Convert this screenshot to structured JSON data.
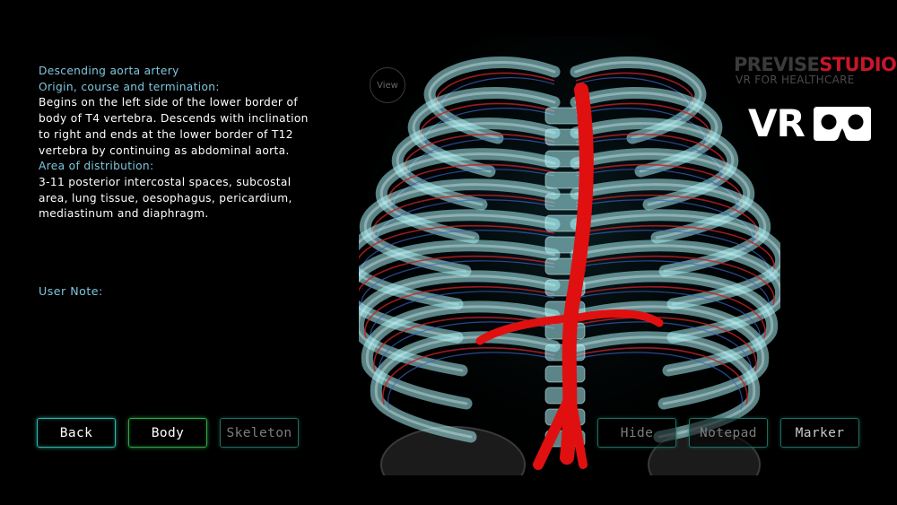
{
  "info": {
    "title": "Descending aorta artery",
    "origin_heading": "Origin, course and termination:",
    "origin_lines": [
      "Begins on the left side of the lower border of",
      "body of T4 vertebra. Descends with inclination",
      "to right and ends at the lower border of T12",
      "vertebra by continuing as abdominal aorta."
    ],
    "area_heading": "Area of distribution:",
    "area_lines": [
      "3-11 posterior intercostal spaces, subcostal",
      "area, lung tissue, oesophagus, pericardium,",
      "mediastinum and diaphragm."
    ],
    "user_note_label": "User Note:"
  },
  "branding": {
    "name_part1": "PREVISE",
    "name_part2": "STUDIO",
    "tagline": "VR FOR HEALTHCARE",
    "vr_text": "VR",
    "vr_icon": "vr-headset-icon"
  },
  "view_button": {
    "label": "View"
  },
  "buttons": {
    "back": "Back",
    "body": "Body",
    "skeleton": "Skeleton",
    "hide": "Hide",
    "notepad": "Notepad",
    "marker": "Marker"
  },
  "colors": {
    "accent_teal": "#2fb8a8",
    "accent_green": "#2ea84a",
    "heading_blue": "#7fc6de",
    "artery_red": "#e01010",
    "bone_cyan": "#a8eef2",
    "brand_red": "#c8162a"
  }
}
